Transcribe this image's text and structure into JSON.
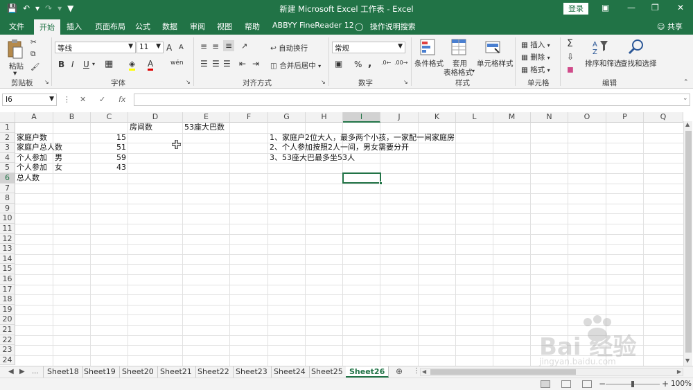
{
  "title_bar": {
    "title": "新建 Microsoft Excel 工作表  -  Excel",
    "login_label": "登录"
  },
  "tabs": [
    "文件",
    "开始",
    "插入",
    "页面布局",
    "公式",
    "数据",
    "审阅",
    "视图",
    "帮助",
    "ABBYY FineReader 12"
  ],
  "active_tab": "开始",
  "tell_me": "操作说明搜索",
  "share": "共享",
  "ribbon": {
    "clipboard": {
      "paste": "粘贴",
      "label": "剪贴板"
    },
    "font": {
      "name": "等线",
      "size": "11",
      "label": "字体",
      "bold": "B",
      "italic": "I",
      "underline": "U",
      "grow": "A",
      "shrink": "A",
      "phonetic": "wén"
    },
    "alignment": {
      "wrap_text": "自动换行",
      "merge_center": "合并后居中",
      "label": "对齐方式"
    },
    "number": {
      "format": "常规",
      "percent": "%",
      "comma": ",",
      "label": "数字"
    },
    "styles": {
      "conditional": "条件格式",
      "table_line1": "套用",
      "table_line2": "表格格式",
      "cell_styles": "单元格样式",
      "label": "样式"
    },
    "cells": {
      "insert": "插入",
      "delete": "删除",
      "format": "格式",
      "label": "单元格"
    },
    "editing": {
      "sort_filter": "排序和筛选",
      "find_select": "查找和选择",
      "label": "编辑"
    }
  },
  "formula_bar": {
    "name_box": "I6",
    "fx": "fx",
    "formula": ""
  },
  "grid": {
    "columns": [
      "A",
      "B",
      "C",
      "D",
      "E",
      "F",
      "G",
      "H",
      "I",
      "J",
      "K",
      "L",
      "M",
      "N",
      "O",
      "P",
      "Q"
    ],
    "rows": [
      "1",
      "2",
      "3",
      "4",
      "5",
      "6",
      "7",
      "8",
      "9",
      "10",
      "11",
      "12",
      "13",
      "14",
      "15",
      "16",
      "17",
      "18",
      "19",
      "20",
      "21",
      "22",
      "23",
      "24"
    ],
    "selected_cell": "I6",
    "cells": {
      "D1": "房间数",
      "E1": "53座大巴数",
      "A2": "家庭户数",
      "C2": "15",
      "A3": "家庭户总人数",
      "C3": "51",
      "A4": "个人参加",
      "B4": "男",
      "C4": "59",
      "A5": "个人参加",
      "B5": "女",
      "C5": "43",
      "A6": "总人数",
      "G2": "1、家庭户2位大人，最多两个小孩，一家配一间家庭房",
      "G3": "2、个人参加按照2人一间，男女需要分开",
      "G4": "3、53座大巴最多坐53人"
    }
  },
  "sheet_tabs": [
    "Sheet18",
    "Sheet19",
    "Sheet20",
    "Sheet21",
    "Sheet22",
    "Sheet23",
    "Sheet24",
    "Sheet25",
    "Sheet26"
  ],
  "active_sheet": "Sheet26",
  "sheet_nav_more": "...",
  "status_bar": {
    "zoom": "100%",
    "zoom_minus": "−",
    "zoom_plus": "+",
    "zoom_fraction": 0.5
  },
  "watermark": {
    "text": "Bai 经验",
    "url": "jingyan.baidu.com"
  },
  "colors": {
    "accent": "#217346",
    "ribbon_bg": "#f3f3f3"
  }
}
